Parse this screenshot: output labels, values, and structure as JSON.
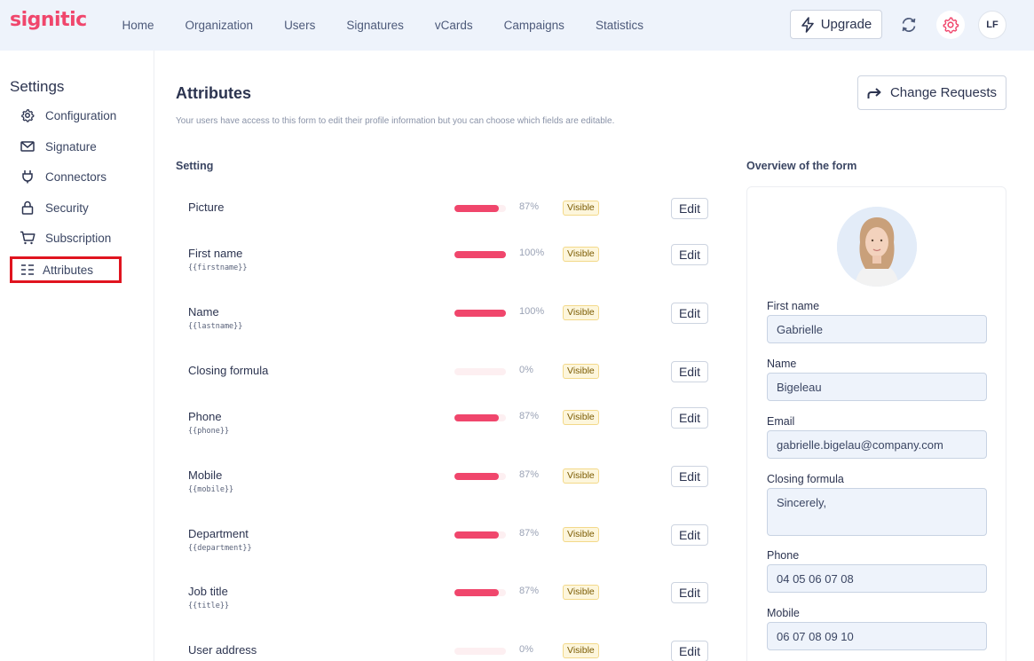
{
  "brand": {
    "logo": "signitic",
    "accent": "#f0466c"
  },
  "nav": {
    "items": [
      "Home",
      "Organization",
      "Users",
      "Signatures",
      "vCards",
      "Campaigns",
      "Statistics"
    ]
  },
  "topbar": {
    "upgrade_label": "Upgrade",
    "avatar_initials": "LF"
  },
  "sidebar": {
    "title": "Settings",
    "items": [
      {
        "label": "Configuration",
        "icon": "gear-icon"
      },
      {
        "label": "Signature",
        "icon": "mail-icon"
      },
      {
        "label": "Connectors",
        "icon": "plug-icon"
      },
      {
        "label": "Security",
        "icon": "lock-icon"
      },
      {
        "label": "Subscription",
        "icon": "cart-icon"
      },
      {
        "label": "Attributes",
        "icon": "list-icon",
        "active": true
      }
    ]
  },
  "main": {
    "title": "Attributes",
    "description": "Your users have access to this form to edit their profile information but you can choose which fields are editable.",
    "change_requests_label": "Change Requests",
    "setting_label": "Setting",
    "overview_label": "Overview of the form"
  },
  "attributes": [
    {
      "name": "Picture",
      "var": "",
      "percent": 87,
      "percent_label": "87%",
      "status": "Visible",
      "edit": "Edit"
    },
    {
      "name": "First name",
      "var": "{{firstname}}",
      "percent": 100,
      "percent_label": "100%",
      "status": "Visible",
      "edit": "Edit"
    },
    {
      "name": "Name",
      "var": "{{lastname}}",
      "percent": 100,
      "percent_label": "100%",
      "status": "Visible",
      "edit": "Edit"
    },
    {
      "name": "Closing formula",
      "var": "",
      "percent": 0,
      "percent_label": "0%",
      "status": "Visible",
      "edit": "Edit"
    },
    {
      "name": "Phone",
      "var": "{{phone}}",
      "percent": 87,
      "percent_label": "87%",
      "status": "Visible",
      "edit": "Edit"
    },
    {
      "name": "Mobile",
      "var": "{{mobile}}",
      "percent": 87,
      "percent_label": "87%",
      "status": "Visible",
      "edit": "Edit"
    },
    {
      "name": "Department",
      "var": "{{department}}",
      "percent": 87,
      "percent_label": "87%",
      "status": "Visible",
      "edit": "Edit"
    },
    {
      "name": "Job title",
      "var": "{{title}}",
      "percent": 87,
      "percent_label": "87%",
      "status": "Visible",
      "edit": "Edit"
    },
    {
      "name": "User address",
      "var": "",
      "percent": 0,
      "percent_label": "0%",
      "status": "Visible",
      "edit": "Edit"
    }
  ],
  "overview": {
    "fields": [
      {
        "label": "First name",
        "value": "Gabrielle"
      },
      {
        "label": "Name",
        "value": "Bigeleau"
      },
      {
        "label": "Email",
        "value": "gabrielle.bigelau@company.com"
      },
      {
        "label": "Closing formula",
        "value": "Sincerely,"
      },
      {
        "label": "Phone",
        "value": "04 05 06 07 08"
      },
      {
        "label": "Mobile",
        "value": "06 07 08 09 10"
      }
    ]
  }
}
